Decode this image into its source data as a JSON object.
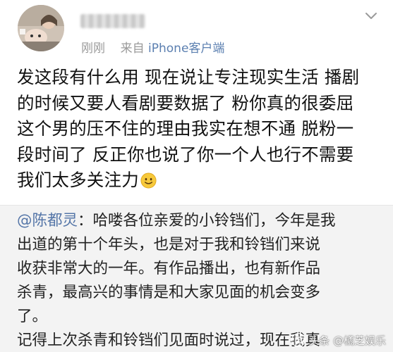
{
  "header": {
    "timestamp": "刚刚",
    "source_prefix": "来自",
    "source_client": "iPhone客户端",
    "menu_icon": "chevron-down-icon"
  },
  "post": {
    "lines": [
      "发这段有什么用 现在说让专注现实生活 播剧",
      "的时候又要人看剧要数据了 粉你真的很委屈",
      "这个男的压不住的理由我实在想不通 脱粉一",
      "段时间了 反正你也说了你一个人也行不需要",
      "我们太多关注力"
    ],
    "emoji": "smile-emoji-icon"
  },
  "quoted": {
    "mention": "@陈都灵",
    "lines": [
      "：哈喽各位亲爱的小铃铛们，今年是我",
      "出道的第十个年头，也是对于我和铃铛们来说",
      "收获非常大的一年。有作品播出，也有新作品",
      "杀青，最高兴的事情是和大家见面的机会变多",
      "了。",
      "记得上次杀青和铃铛们见面时说过，现在我真"
    ]
  },
  "watermark": {
    "text": "头条 @橘芝娱乐"
  },
  "colors": {
    "link": "#5576a8",
    "meta": "#9a9a9a",
    "quote_bg": "#f3f3f3"
  }
}
